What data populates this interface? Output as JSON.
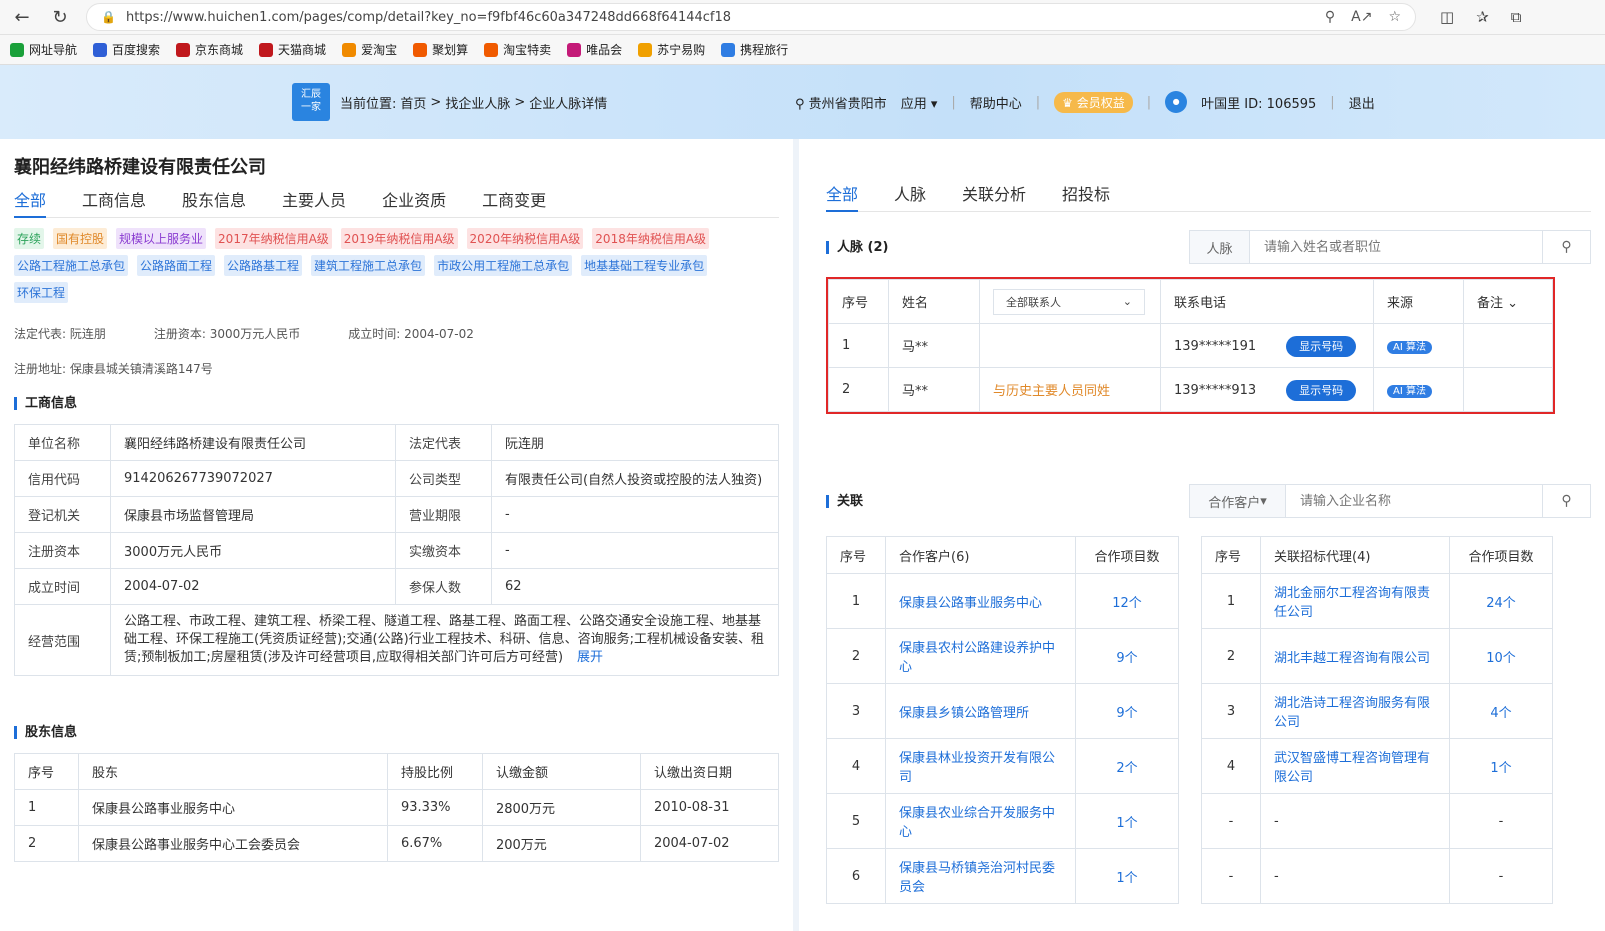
{
  "browser": {
    "url": "https://www.huichen1.com/pages/comp/detail?key_no=f9fbf46c60a347248dd668f64144cf18",
    "bookmarks": [
      "网址导航",
      "百度搜索",
      "京东商城",
      "天猫商城",
      "爱淘宝",
      "聚划算",
      "淘宝特卖",
      "唯品会",
      "苏宁易购",
      "携程旅行"
    ]
  },
  "header": {
    "logo_text_1": "汇辰",
    "logo_text_2": "一家",
    "crumb_label": "当前位置:",
    "crumb_home": "首页",
    "crumb_find": "找企业人脉",
    "crumb_detail": "企业人脉详情",
    "location": "贵州省贵阳市",
    "apps": "应用",
    "help": "帮助中心",
    "vip": "会员权益",
    "user": "叶国里 ID: 106595",
    "logout": "退出"
  },
  "company": {
    "name": "襄阳经纬路桥建设有限责任公司",
    "tabs": [
      "全部",
      "工商信息",
      "股东信息",
      "主要人员",
      "企业资质",
      "工商变更"
    ],
    "tags": [
      {
        "text": "存续",
        "color": "green"
      },
      {
        "text": "国有控股",
        "color": "orange"
      },
      {
        "text": "规模以上服务业",
        "color": "purple"
      },
      {
        "text": "2017年纳税信用A级",
        "color": "red"
      },
      {
        "text": "2019年纳税信用A级",
        "color": "red"
      },
      {
        "text": "2020年纳税信用A级",
        "color": "red"
      },
      {
        "text": "2018年纳税信用A级",
        "color": "red"
      },
      {
        "text": "公路工程施工总承包",
        "color": "blue"
      },
      {
        "text": "公路路面工程",
        "color": "blue"
      },
      {
        "text": "公路路基工程",
        "color": "blue"
      },
      {
        "text": "建筑工程施工总承包",
        "color": "blue"
      },
      {
        "text": "市政公用工程施工总承包",
        "color": "blue"
      },
      {
        "text": "地基基础工程专业承包",
        "color": "blue"
      },
      {
        "text": "环保工程",
        "color": "blue"
      }
    ],
    "legal_rep": "法定代表: 阮连朋",
    "reg_capital": "注册资本: 3000万元人民币",
    "founded": "成立时间: 2004-07-02",
    "address": "注册地址: 保康县城关镇清溪路147号"
  },
  "biz_info": {
    "title": "工商信息",
    "rows": [
      [
        "单位名称",
        "襄阳经纬路桥建设有限责任公司",
        "法定代表",
        "阮连朋"
      ],
      [
        "信用代码",
        "914206267739072027",
        "公司类型",
        "有限责任公司(自然人投资或控股的法人独资)"
      ],
      [
        "登记机关",
        "保康县市场监督管理局",
        "营业期限",
        "-"
      ],
      [
        "注册资本",
        "3000万元人民币",
        "实缴资本",
        "-"
      ],
      [
        "成立时间",
        "2004-07-02",
        "参保人数",
        "62"
      ]
    ],
    "scope_label": "经营范围",
    "scope": "公路工程、市政工程、建筑工程、桥梁工程、隧道工程、路基工程、路面工程、公路交通安全设施工程、地基基础工程、环保工程施工(凭资质证经营);交通(公路)行业工程技术、科研、信息、咨询服务;工程机械设备安装、租赁;预制板加工;房屋租赁(涉及许可经营项目,应取得相关部门许可后方可经营)",
    "expand": "展开"
  },
  "shareholders": {
    "title": "股东信息",
    "headers": [
      "序号",
      "股东",
      "持股比例",
      "认缴金额",
      "认缴出资日期"
    ],
    "rows": [
      [
        "1",
        "保康县公路事业服务中心",
        "93.33%",
        "2800万元",
        "2010-08-31"
      ],
      [
        "2",
        "保康县公路事业服务中心工会委员会",
        "6.67%",
        "200万元",
        "2004-07-02"
      ]
    ]
  },
  "right": {
    "tabs": [
      "全部",
      "人脉",
      "关联分析",
      "招投标"
    ],
    "people_title": "人脉 (2)",
    "people_search_label": "人脉",
    "people_search_placeholder": "请输入姓名或者职位",
    "people_headers": {
      "no": "序号",
      "name": "姓名",
      "filter": "全部联系人",
      "phone": "联系电话",
      "source": "来源",
      "note": "备注"
    },
    "people": [
      {
        "no": "1",
        "name": "马**",
        "relation": "",
        "phone": "139*****191",
        "btn": "显示号码",
        "source": "AI 算法"
      },
      {
        "no": "2",
        "name": "马**",
        "relation": "与历史主要人员同姓",
        "phone": "139*****913",
        "btn": "显示号码",
        "source": "AI 算法"
      }
    ],
    "rel_title": "关联",
    "rel_search_label": "合作客户",
    "rel_search_placeholder": "请输入企业名称",
    "clients_headers": [
      "序号",
      "合作客户(6)",
      "合作项目数"
    ],
    "clients": [
      [
        "1",
        "保康县公路事业服务中心",
        "12个"
      ],
      [
        "2",
        "保康县农村公路建设养护中心",
        "9个"
      ],
      [
        "3",
        "保康县乡镇公路管理所",
        "9个"
      ],
      [
        "4",
        "保康县林业投资开发有限公司",
        "2个"
      ],
      [
        "5",
        "保康县农业综合开发服务中心",
        "1个"
      ],
      [
        "6",
        "保康县马桥镇尧治河村民委员会",
        "1个"
      ]
    ],
    "agents_headers": [
      "序号",
      "关联招标代理(4)",
      "合作项目数"
    ],
    "agents": [
      [
        "1",
        "湖北金丽尔工程咨询有限责任公司",
        "24个"
      ],
      [
        "2",
        "湖北丰越工程咨询有限公司",
        "10个"
      ],
      [
        "3",
        "湖北浩诗工程咨询服务有限公司",
        "4个"
      ],
      [
        "4",
        "武汉智盛博工程咨询管理有限公司",
        "1个"
      ],
      [
        "-",
        "-",
        "-"
      ],
      [
        "-",
        "-",
        "-"
      ]
    ]
  }
}
